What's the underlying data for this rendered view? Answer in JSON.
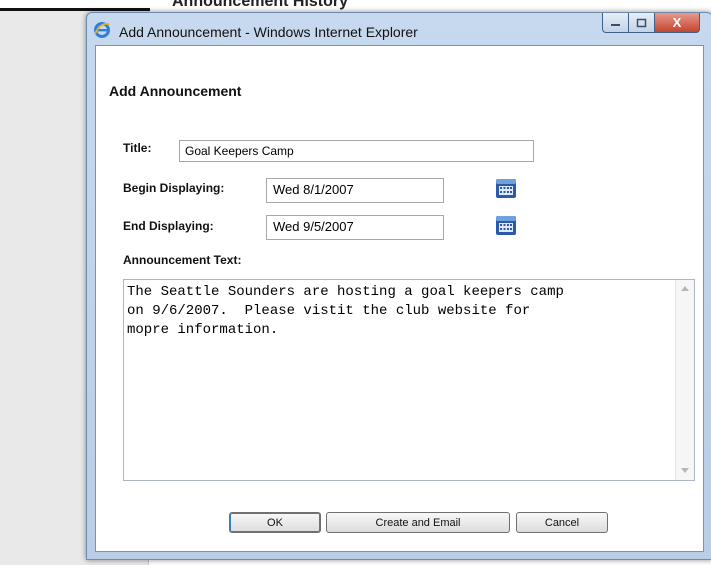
{
  "background": {
    "heading": "Announcement History"
  },
  "window": {
    "title": "Add Announcement - Windows Internet Explorer",
    "icon": "ie-icon",
    "caption_buttons": [
      "minimize",
      "maximize",
      "close"
    ],
    "close_glyph": "X"
  },
  "form": {
    "heading": "Add Announcement",
    "title_label": "Title:",
    "title_value": "Goal Keepers Camp",
    "begin_label": "Begin Displaying:",
    "begin_value": "Wed 8/1/2007",
    "end_label": "End Displaying:",
    "end_value": "Wed 9/5/2007",
    "text_label": "Announcement Text:",
    "text_value": "The Seattle Sounders are hosting a goal keepers camp\non 9/6/2007.  Please vistit the club website for\nmopre information."
  },
  "buttons": {
    "ok": "OK",
    "create_email": "Create and Email",
    "cancel": "Cancel"
  },
  "colors": {
    "window_frame": "#c7d9ee",
    "close_button": "#c4452f",
    "calendar_icon": "#2a5aa8"
  }
}
